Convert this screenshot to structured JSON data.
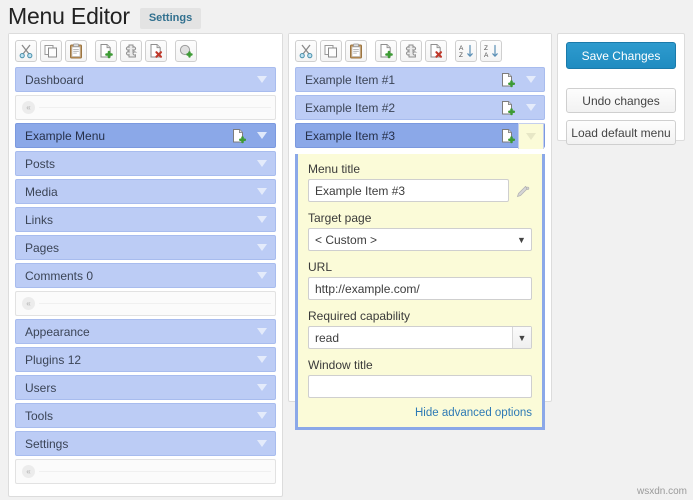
{
  "header": {
    "title": "Menu Editor",
    "tag": "Settings"
  },
  "toolbar_left": {
    "buttons": [
      {
        "name": "cut",
        "icon": "scissors-icon"
      },
      {
        "name": "copy",
        "icon": "copy-icon"
      },
      {
        "name": "paste",
        "icon": "clipboard-icon"
      },
      {
        "name": "new-menu",
        "icon": "new-page-icon"
      },
      {
        "name": "new-separator",
        "icon": "puzzle-icon"
      },
      {
        "name": "delete-menu",
        "icon": "delete-page-icon"
      },
      {
        "name": "show-hidden",
        "icon": "show-hidden-icon"
      }
    ]
  },
  "toolbar_mid": {
    "buttons": [
      {
        "name": "cut",
        "icon": "scissors-icon"
      },
      {
        "name": "copy",
        "icon": "copy-icon"
      },
      {
        "name": "paste",
        "icon": "clipboard-icon"
      },
      {
        "name": "new-item",
        "icon": "new-page-icon"
      },
      {
        "name": "new-separator",
        "icon": "puzzle-icon"
      },
      {
        "name": "delete-item",
        "icon": "delete-page-icon"
      },
      {
        "name": "sort-ascending",
        "icon": "sort-az-icon"
      },
      {
        "name": "sort-descending",
        "icon": "sort-za-icon"
      }
    ]
  },
  "sidebar": {
    "rows": [
      {
        "type": "menu",
        "label": "Dashboard",
        "selected": false,
        "has_icon": false
      },
      {
        "type": "separator"
      },
      {
        "type": "menu",
        "label": "Example Menu",
        "selected": true,
        "has_icon": true
      },
      {
        "type": "menu",
        "label": "Posts",
        "selected": false,
        "has_icon": false
      },
      {
        "type": "menu",
        "label": "Media",
        "selected": false,
        "has_icon": false
      },
      {
        "type": "menu",
        "label": "Links",
        "selected": false,
        "has_icon": false
      },
      {
        "type": "menu",
        "label": "Pages",
        "selected": false,
        "has_icon": false
      },
      {
        "type": "menu",
        "label": "Comments 0",
        "selected": false,
        "has_icon": false
      },
      {
        "type": "separator"
      },
      {
        "type": "menu",
        "label": "Appearance",
        "selected": false,
        "has_icon": false
      },
      {
        "type": "menu",
        "label": "Plugins 12",
        "selected": false,
        "has_icon": false
      },
      {
        "type": "menu",
        "label": "Users",
        "selected": false,
        "has_icon": false
      },
      {
        "type": "menu",
        "label": "Tools",
        "selected": false,
        "has_icon": false
      },
      {
        "type": "menu",
        "label": "Settings",
        "selected": false,
        "has_icon": false
      },
      {
        "type": "separator"
      }
    ]
  },
  "submenu": {
    "rows": [
      {
        "label": "Example Item #1",
        "active": false
      },
      {
        "label": "Example Item #2",
        "active": false
      },
      {
        "label": "Example Item #3",
        "active": true
      }
    ]
  },
  "edit_form": {
    "menu_title_label": "Menu title",
    "menu_title_value": "Example Item #3",
    "target_page_label": "Target page",
    "target_page_value": "< Custom >",
    "url_label": "URL",
    "url_value": "http://example.com/",
    "capability_label": "Required capability",
    "capability_value": "read",
    "window_title_label": "Window title",
    "window_title_value": "",
    "window_title_placeholder": "",
    "advanced_link": "Hide advanced options"
  },
  "actions": {
    "save_label": "Save Changes",
    "undo_label": "Undo changes",
    "load_default_label": "Load default menu"
  },
  "watermark": "wsxdn.com",
  "colors": {
    "accent_blue": "#2e9bce",
    "row_blue": "#bcccf5",
    "row_blue_selected": "#8ba8e8",
    "form_yellow": "#fbfbd8",
    "link_blue": "#2e7ab5",
    "page_bg": "#f1f1f1"
  }
}
